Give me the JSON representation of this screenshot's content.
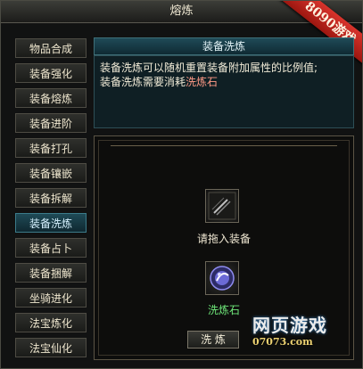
{
  "window": {
    "title": "熔炼"
  },
  "ribbon": "8090游戏",
  "sidebar": {
    "items": [
      {
        "label": "物品合成"
      },
      {
        "label": "装备强化"
      },
      {
        "label": "装备熔炼"
      },
      {
        "label": "装备进阶"
      },
      {
        "label": "装备打孔"
      },
      {
        "label": "装备镶嵌"
      },
      {
        "label": "装备拆解"
      },
      {
        "label": "装备洗炼"
      },
      {
        "label": "装备占卜"
      },
      {
        "label": "装备捆解"
      },
      {
        "label": "坐骑进化"
      },
      {
        "label": "法宝炼化"
      },
      {
        "label": "法宝仙化"
      }
    ]
  },
  "description": {
    "title": "装备洗炼",
    "line1": "装备洗炼可以随机重置装备附加属性的比例值;",
    "line2_prefix": "装备洗炼需要消耗",
    "line2_highlight": "洗炼石"
  },
  "panel": {
    "equip_slot_label": "请拖入装备",
    "stone_slot_label": "洗炼石",
    "wash_button_label": "洗 炼"
  },
  "watermark": {
    "main": "网页游戏",
    "sub": "07073.com"
  }
}
